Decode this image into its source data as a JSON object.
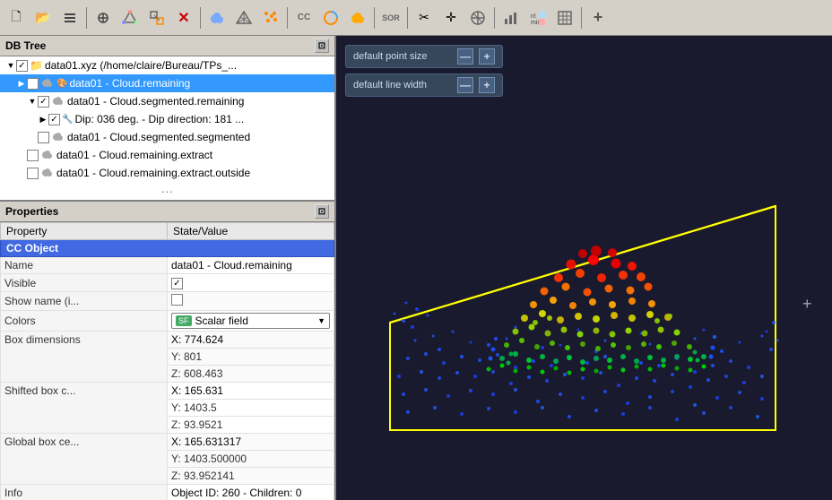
{
  "toolbar": {
    "buttons": [
      {
        "name": "new",
        "icon": "🗋"
      },
      {
        "name": "open",
        "icon": "📂"
      },
      {
        "name": "list",
        "icon": "☰"
      },
      {
        "name": "add-point",
        "icon": "✛"
      },
      {
        "name": "segment",
        "icon": "⚑"
      },
      {
        "name": "transform",
        "icon": "⟳"
      },
      {
        "name": "delete",
        "icon": "✕"
      },
      {
        "name": "cloud",
        "icon": "☁"
      },
      {
        "name": "mesh",
        "icon": "⬡"
      },
      {
        "name": "scatter",
        "icon": "⋯"
      },
      {
        "name": "seg1",
        "icon": "SG"
      },
      {
        "name": "seg2",
        "icon": "SOR"
      },
      {
        "name": "cut",
        "icon": "✂"
      },
      {
        "name": "cross",
        "icon": "✛"
      },
      {
        "name": "move",
        "icon": "⊕"
      },
      {
        "name": "chart",
        "icon": "📊"
      },
      {
        "name": "minmax",
        "icon": "↕"
      },
      {
        "name": "grid",
        "icon": "▦"
      },
      {
        "name": "plus",
        "icon": "+"
      }
    ]
  },
  "db_tree": {
    "title": "DB Tree",
    "items": [
      {
        "id": "root",
        "label": "data01.xyz (/home/claire/Bureau/TPs_...",
        "indent": 0,
        "expanded": true,
        "checked": true,
        "icon": "📁"
      },
      {
        "id": "data01-remaining",
        "label": "data01 - Cloud.remaining",
        "indent": 1,
        "expanded": false,
        "checked": true,
        "selected": true,
        "icon": "☁"
      },
      {
        "id": "data01-segmented-remaining",
        "label": "data01 - Cloud.segmented.remaining",
        "indent": 2,
        "expanded": true,
        "checked": true,
        "icon": "☁"
      },
      {
        "id": "dip",
        "label": "Dip: 036 deg. - Dip direction: 181 ...",
        "indent": 3,
        "expanded": false,
        "checked": true,
        "icon": "🔧"
      },
      {
        "id": "data01-segmented-segmented",
        "label": "data01 - Cloud.segmented.segmented",
        "indent": 2,
        "checked": false,
        "icon": "☁"
      },
      {
        "id": "data01-remaining-extract",
        "label": "data01 - Cloud.remaining.extract",
        "indent": 1,
        "checked": false,
        "icon": "☁"
      },
      {
        "id": "data01-remaining-extract-outside",
        "label": "data01 - Cloud.remaining.extract.outside",
        "indent": 1,
        "checked": false,
        "icon": "☁"
      }
    ]
  },
  "properties": {
    "title": "Properties",
    "columns": [
      "Property",
      "State/Value"
    ],
    "section": "CC Object",
    "rows": [
      {
        "property": "Name",
        "value": "data01 - Cloud.remaining"
      },
      {
        "property": "Visible",
        "value": "✓",
        "type": "checkbox"
      },
      {
        "property": "Show name (i...",
        "value": "",
        "type": "checkbox-empty"
      },
      {
        "property": "Colors",
        "value": "Scalar field",
        "type": "dropdown",
        "icon": "SF"
      },
      {
        "property": "Box dimensions",
        "value": "X: 774.624\nY: 801\nZ: 608.463",
        "type": "multiline"
      },
      {
        "property": "Shifted box c...",
        "value": "X: 165.631\nY: 1403.5\nZ: 93.9521",
        "type": "multiline"
      },
      {
        "property": "Global box ce...",
        "value": "X: 165.631317\nY: 1403.500000\nZ: 93.952141",
        "type": "multiline"
      },
      {
        "property": "Info",
        "value": "Object ID: 260 - Children: 0"
      }
    ]
  },
  "viewport": {
    "controls": [
      {
        "label": "default point size",
        "value": ""
      },
      {
        "label": "default line width",
        "value": ""
      }
    ],
    "minus_symbol": "—",
    "plus_symbol": "+"
  }
}
